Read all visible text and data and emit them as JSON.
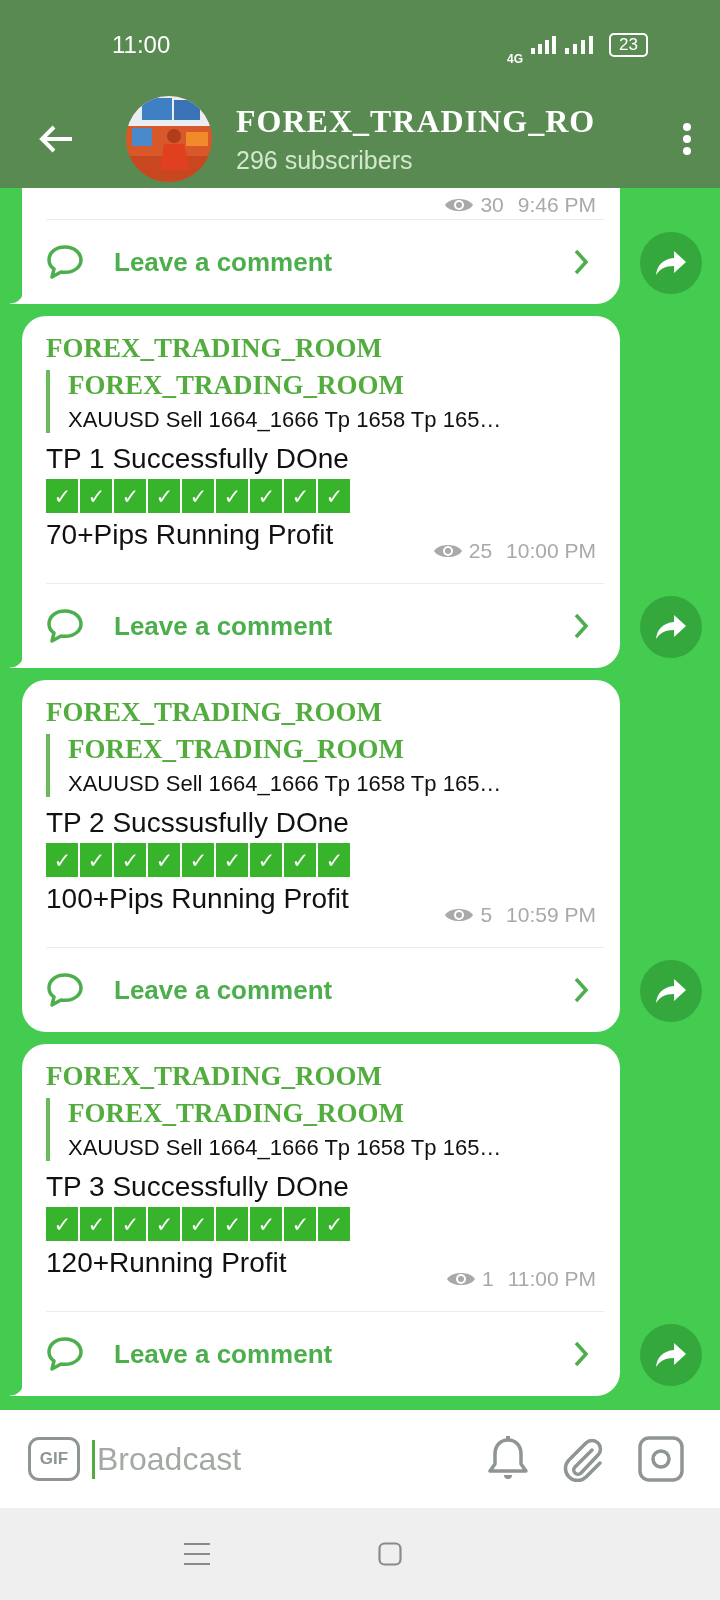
{
  "status_bar": {
    "time": "11:00",
    "network": "4G",
    "battery": "23"
  },
  "header": {
    "title": "FOREX_TRADING_RO",
    "subtitle": "296 subscribers"
  },
  "messages": [
    {
      "views": "30",
      "time": "9:46 PM",
      "comment": "Leave a comment",
      "tail": true
    },
    {
      "author": "FOREX_TRADING_ROOM",
      "reply": {
        "author": "FOREX_TRADING_ROOM",
        "text": "XAUUSD  Sell 1664_1666  Tp 1658 Tp 165…"
      },
      "title": "TP 1 Successfully DOne",
      "checks": "✓✓✓✓✓✓✓✓✓",
      "profit": "70+Pips Running Profit",
      "views": "25",
      "time": "10:00 PM",
      "comment": "Leave a comment",
      "tail": true
    },
    {
      "author": "FOREX_TRADING_ROOM",
      "reply": {
        "author": "FOREX_TRADING_ROOM",
        "text": "XAUUSD  Sell 1664_1666  Tp 1658 Tp 165…"
      },
      "title": "TP 2 Sucssusfully DOne",
      "checks": "✓✓✓✓✓✓✓✓✓",
      "profit": "100+Pips Running Profit",
      "views": "5",
      "time": "10:59 PM",
      "comment": "Leave a comment",
      "tail": false
    },
    {
      "author": "FOREX_TRADING_ROOM",
      "reply": {
        "author": "FOREX_TRADING_ROOM",
        "text": "XAUUSD  Sell 1664_1666  Tp 1658 Tp 165…"
      },
      "title": "TP 3 Successfully DOne",
      "checks": "✓✓✓✓✓✓✓✓✓",
      "profit": "120+Running Profit",
      "views": "1",
      "time": "11:00 PM",
      "comment": "Leave a comment",
      "tail": true
    }
  ],
  "composer": {
    "gif": "GIF",
    "placeholder": "Broadcast"
  }
}
